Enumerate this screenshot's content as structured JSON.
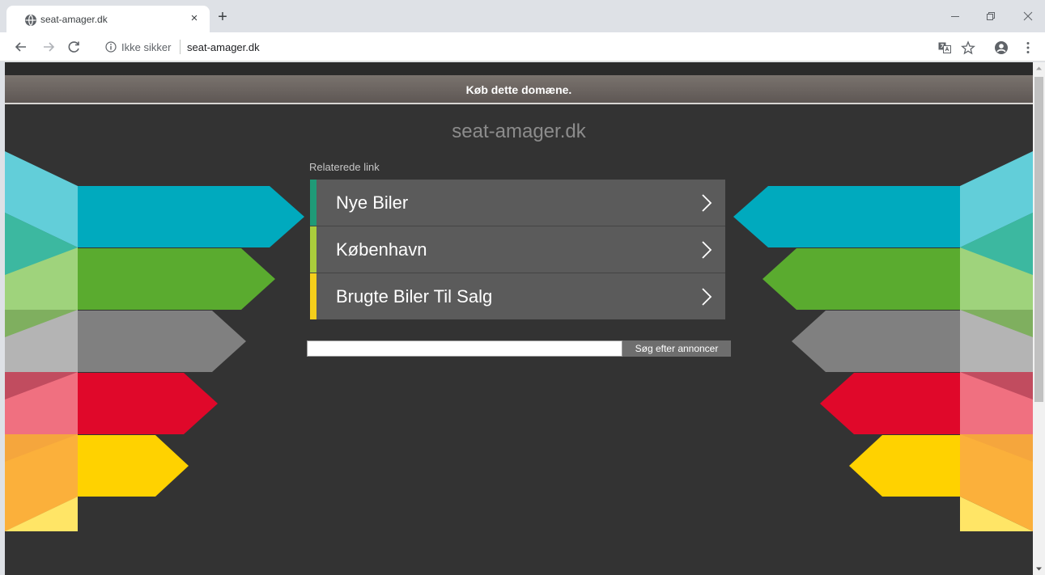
{
  "browser": {
    "tab_title": "seat-amager.dk",
    "close_glyph": "×",
    "newtab_glyph": "+",
    "security_label": "Ikke sikker",
    "url": "seat-amager.dk"
  },
  "page": {
    "buy_banner": "Køb dette domæne.",
    "domain_title": "seat-amager.dk",
    "related_label": "Relaterede link",
    "links": [
      {
        "label": "Nye Biler",
        "accent": "#1f9a77"
      },
      {
        "label": "København",
        "accent": "#aacd3c"
      },
      {
        "label": "Brugte Biler Til Salg",
        "accent": "#f5cf1b"
      }
    ],
    "search": {
      "value": "",
      "button_label": "Søg efter annoncer"
    }
  },
  "colors": {
    "page_bg": "#333333",
    "link_bg": "#5b5b5b",
    "arrows": [
      "#00aabe",
      "#5aab2f",
      "#808080",
      "#e0082a",
      "#ffd200"
    ]
  },
  "icons": [
    "globe-icon",
    "close-icon",
    "plus-icon",
    "minimize-icon",
    "restore-icon",
    "window-close-icon",
    "back-arrow-icon",
    "forward-arrow-icon",
    "reload-icon",
    "info-icon",
    "translate-icon",
    "star-icon",
    "account-icon",
    "menu-dots-icon",
    "chevron-right-icon"
  ]
}
